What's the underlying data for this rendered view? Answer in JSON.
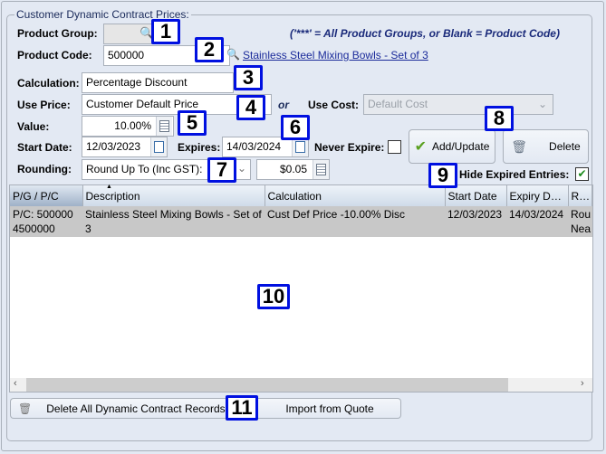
{
  "group_title": "Customer Dynamic Contract Prices:",
  "hint": "('***' = All Product Groups, or Blank = Product Code)",
  "labels": {
    "product_group": "Product Group:",
    "product_code": "Product Code:",
    "calculation": "Calculation:",
    "use_price": "Use Price:",
    "or": "or",
    "use_cost": "Use Cost:",
    "value": "Value:",
    "start_date": "Start Date:",
    "expires": "Expires:",
    "never_expire": "Never Expire:",
    "rounding": "Rounding:",
    "hide_expired": "Hide Expired Entries:"
  },
  "fields": {
    "product_group": "",
    "product_code": "500000",
    "product_link": "Stainless Steel Mixing Bowls - Set of 3",
    "calculation": "Percentage Discount",
    "use_price": "Customer Default Price",
    "use_cost": "Default Cost",
    "value": "10.00%",
    "start_date": "12/03/2023",
    "expires": "14/03/2024",
    "rounding": "Round Up To (Inc GST):",
    "rounding_amount": "$0.05"
  },
  "checkboxes": {
    "never_expire": false,
    "hide_expired": true
  },
  "buttons": {
    "add_update": "Add/Update",
    "delete": "Delete",
    "delete_all": "Delete All Dynamic Contract Records",
    "import": "Import from Quote"
  },
  "table": {
    "columns": [
      "P/G / P/C",
      "Description",
      "Calculation",
      "Start Date",
      "Expiry Da...",
      "Rou"
    ],
    "rows": [
      {
        "pc": "P/C: 500000 4500000",
        "description": "Stainless Steel Mixing Bowls - Set of 3",
        "calculation": "Cust Def Price -10.00% Disc",
        "start": "12/03/2023",
        "expiry": "14/03/2024",
        "rounding": "Rou Nea"
      }
    ]
  },
  "badges": [
    "1",
    "2",
    "3",
    "4",
    "5",
    "6",
    "7",
    "8",
    "9",
    "10",
    "11"
  ]
}
